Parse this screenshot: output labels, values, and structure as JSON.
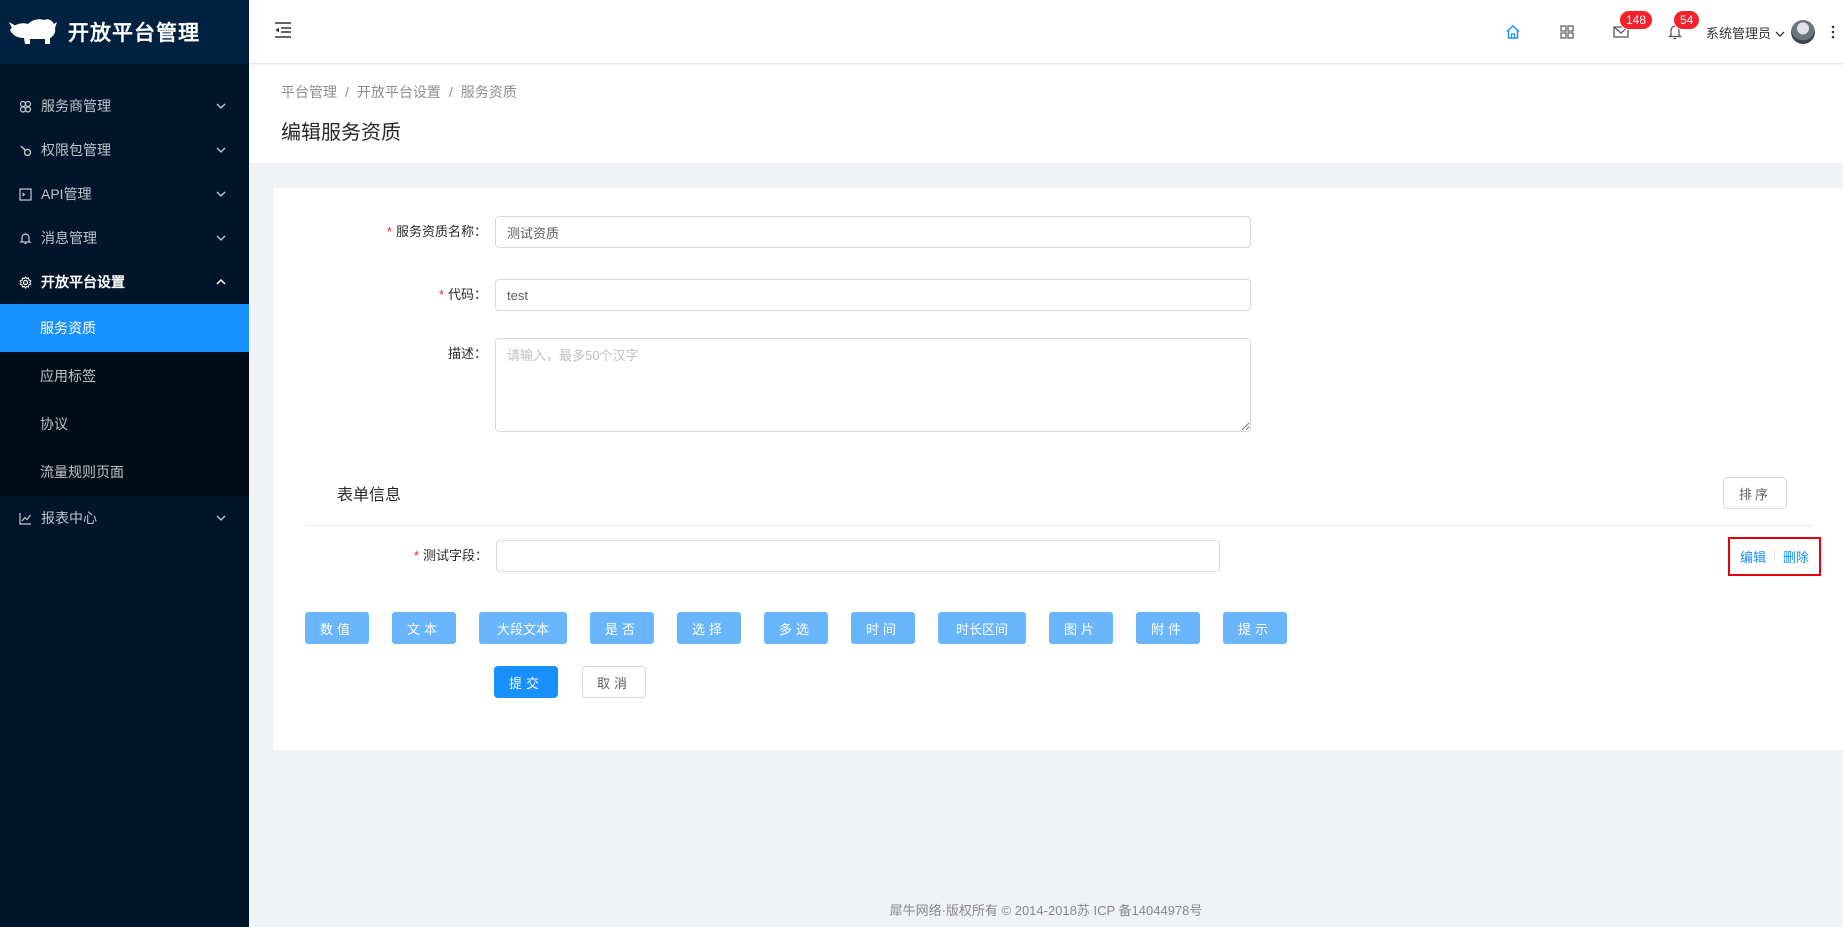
{
  "app": {
    "title": "开放平台管理",
    "logo_icon": "rhino-logo-icon"
  },
  "sidebar": {
    "items": [
      {
        "label": "服务商管理",
        "icon": "cluster-icon"
      },
      {
        "label": "权限包管理",
        "icon": "api-key-icon"
      },
      {
        "label": "API管理",
        "icon": "code-window-icon"
      },
      {
        "label": "消息管理",
        "icon": "bell-icon"
      },
      {
        "label": "开放平台设置",
        "icon": "gear-icon",
        "open": true,
        "children": [
          {
            "label": "服务资质",
            "active": true
          },
          {
            "label": "应用标签"
          },
          {
            "label": "协议"
          },
          {
            "label": "流量规则页面"
          }
        ]
      },
      {
        "label": "报表中心",
        "icon": "line-chart-icon"
      }
    ]
  },
  "header": {
    "mail_count": "148",
    "notice_count": "54",
    "user_name": "系统管理员",
    "accent": "#1890ff"
  },
  "page": {
    "breadcrumb": [
      "平台管理",
      "开放平台设置",
      "服务资质"
    ],
    "title": "编辑服务资质"
  },
  "form": {
    "name_label": "服务资质名称",
    "name_value": "测试资质",
    "code_label": "代码",
    "code_value": "test",
    "desc_label": "描述",
    "desc_placeholder": "请输入，最多50个汉字",
    "colon": "："
  },
  "form_info": {
    "title": "表单信息",
    "sort_label": "排序",
    "field_label": "测试字段",
    "field_value": "",
    "edit_label": "编辑",
    "delete_label": "删除"
  },
  "type_buttons": [
    "数值",
    "文本",
    "大段文本",
    "是否",
    "选择",
    "多选",
    "时间",
    "时长区间",
    "图片",
    "附件",
    "提示"
  ],
  "actions": {
    "submit": "提交",
    "cancel": "取消"
  },
  "footer": {
    "text": "犀牛网络·版权所有 © 2014-2018苏 ICP 备14044978号"
  }
}
